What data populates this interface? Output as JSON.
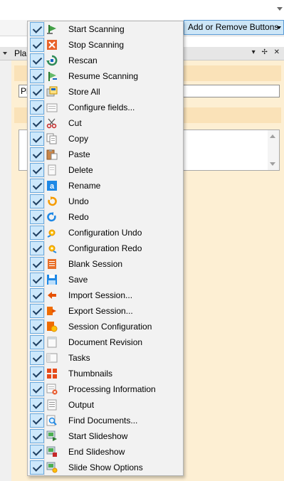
{
  "toolbar": {
    "add_remove_label": "Add or Remove Buttons"
  },
  "panel": {
    "title": "Pla",
    "input_value": "Pl"
  },
  "menu": {
    "items": [
      {
        "label": "Start Scanning",
        "checked": true,
        "icon": "start-scanning-icon"
      },
      {
        "label": "Stop Scanning",
        "checked": true,
        "icon": "stop-scanning-icon"
      },
      {
        "label": "Rescan",
        "checked": true,
        "icon": "rescan-icon"
      },
      {
        "label": "Resume Scanning",
        "checked": true,
        "icon": "resume-scanning-icon"
      },
      {
        "label": "Store All",
        "checked": true,
        "icon": "store-all-icon"
      },
      {
        "label": "Configure fields...",
        "checked": true,
        "icon": "configure-fields-icon"
      },
      {
        "label": "Cut",
        "checked": true,
        "icon": "scissors-icon"
      },
      {
        "label": "Copy",
        "checked": true,
        "icon": "copy-icon"
      },
      {
        "label": "Paste",
        "checked": true,
        "icon": "paste-icon"
      },
      {
        "label": "Delete",
        "checked": true,
        "icon": "delete-icon"
      },
      {
        "label": "Rename",
        "checked": true,
        "icon": "rename-icon"
      },
      {
        "label": "Undo",
        "checked": true,
        "icon": "undo-icon"
      },
      {
        "label": "Redo",
        "checked": true,
        "icon": "redo-icon"
      },
      {
        "label": "Configuration Undo",
        "checked": true,
        "icon": "configuration-undo-icon"
      },
      {
        "label": "Configuration Redo",
        "checked": true,
        "icon": "configuration-redo-icon"
      },
      {
        "label": "Blank Session",
        "checked": true,
        "icon": "blank-session-icon"
      },
      {
        "label": "Save",
        "checked": true,
        "icon": "save-icon"
      },
      {
        "label": "Import Session...",
        "checked": true,
        "icon": "import-session-icon"
      },
      {
        "label": "Export Session...",
        "checked": true,
        "icon": "export-session-icon"
      },
      {
        "label": "Session Configuration",
        "checked": true,
        "icon": "session-configuration-icon"
      },
      {
        "label": "Document Revision",
        "checked": true,
        "icon": "document-revision-icon"
      },
      {
        "label": "Tasks",
        "checked": true,
        "icon": "tasks-icon"
      },
      {
        "label": "Thumbnails",
        "checked": true,
        "icon": "thumbnails-icon"
      },
      {
        "label": "Processing Information",
        "checked": true,
        "icon": "processing-information-icon"
      },
      {
        "label": "Output",
        "checked": true,
        "icon": "output-icon"
      },
      {
        "label": "Find Documents...",
        "checked": true,
        "icon": "find-documents-icon"
      },
      {
        "label": "Start Slideshow",
        "checked": true,
        "icon": "start-slideshow-icon"
      },
      {
        "label": "End Slideshow",
        "checked": true,
        "icon": "end-slideshow-icon"
      },
      {
        "label": "Slide Show Options",
        "checked": true,
        "icon": "slide-show-options-icon"
      }
    ]
  }
}
